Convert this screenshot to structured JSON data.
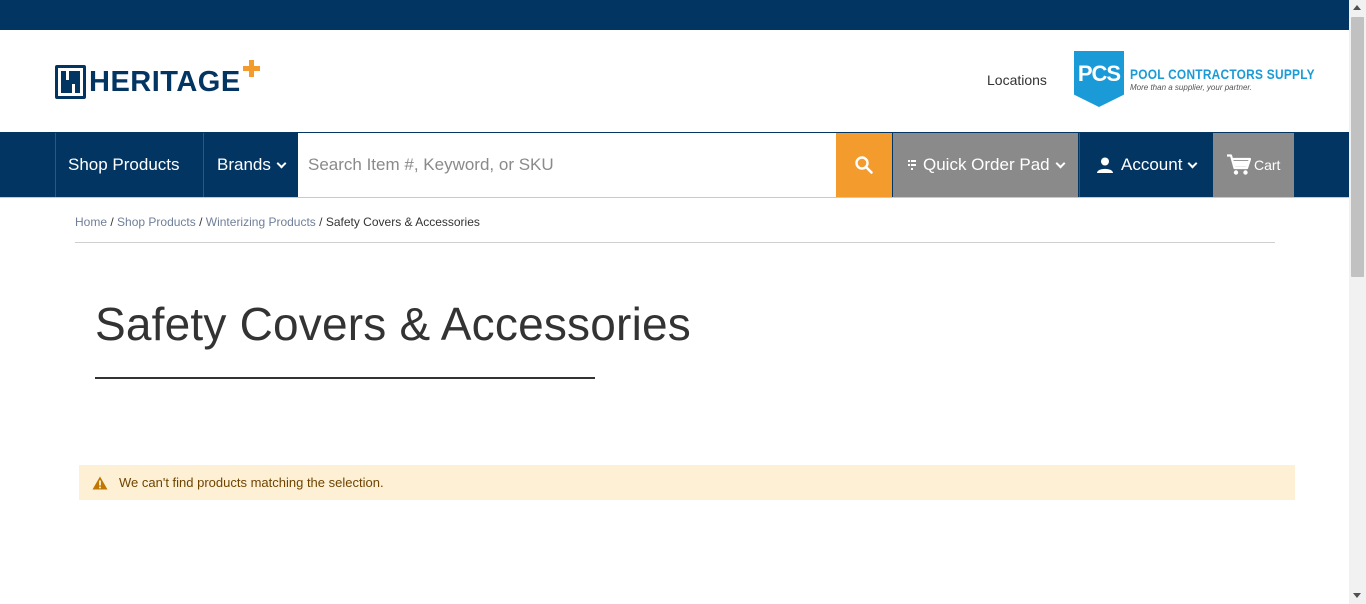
{
  "header": {
    "logo_text": "HERITAGE",
    "locations_label": "Locations",
    "pcs": {
      "initials": "PCS",
      "name": "POOL CONTRACTORS SUPPLY",
      "tagline": "More than a supplier, your partner."
    }
  },
  "nav": {
    "shop_products": "Shop Products",
    "brands": "Brands",
    "search_placeholder": "Search Item #, Keyword, or SKU",
    "quick_order_pad": "Quick Order Pad",
    "account": "Account",
    "cart": "Cart"
  },
  "breadcrumb": {
    "items": [
      "Home",
      "Shop Products",
      "Winterizing Products"
    ],
    "current": "Safety Covers & Accessories"
  },
  "page": {
    "title": "Safety Covers & Accessories",
    "notice": "We can't find products matching the selection."
  },
  "colors": {
    "brand_navy": "#033563",
    "accent_orange": "#f39b2d",
    "pcs_blue": "#1a9ad6",
    "notice_bg": "#fdf0d5"
  }
}
